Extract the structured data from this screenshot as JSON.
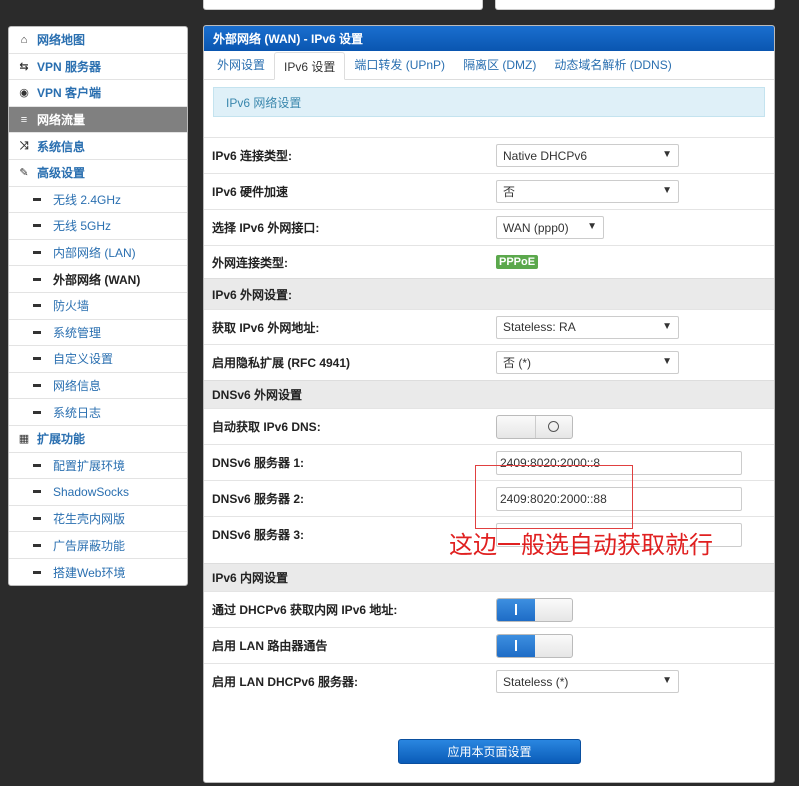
{
  "sidebar": {
    "items": [
      {
        "label": "网络地图",
        "icon": "home-icon",
        "glyph": "⌂",
        "type": "main"
      },
      {
        "label": "VPN 服务器",
        "icon": "retweet-icon",
        "glyph": "⇆",
        "type": "main"
      },
      {
        "label": "VPN 客户端",
        "icon": "globe-icon",
        "glyph": "◉",
        "type": "main"
      },
      {
        "label": "网络流量",
        "icon": "list-icon",
        "glyph": "≡",
        "type": "main",
        "active": true
      },
      {
        "label": "系统信息",
        "icon": "shuffle-icon",
        "glyph": "⤨",
        "type": "main"
      },
      {
        "label": "高级设置",
        "icon": "wrench-icon",
        "glyph": "✎",
        "type": "main"
      },
      {
        "label": "无线 2.4GHz",
        "type": "sub"
      },
      {
        "label": "无线 5GHz",
        "type": "sub"
      },
      {
        "label": "内部网络 (LAN)",
        "type": "sub"
      },
      {
        "label": "外部网络 (WAN)",
        "type": "sub",
        "current": true
      },
      {
        "label": "防火墙",
        "type": "sub"
      },
      {
        "label": "系统管理",
        "type": "sub"
      },
      {
        "label": "自定义设置",
        "type": "sub"
      },
      {
        "label": "网络信息",
        "type": "sub"
      },
      {
        "label": "系统日志",
        "type": "sub"
      },
      {
        "label": "扩展功能",
        "icon": "grid-icon",
        "glyph": "▦",
        "type": "main"
      },
      {
        "label": "配置扩展环境",
        "type": "sub"
      },
      {
        "label": "ShadowSocks",
        "type": "sub"
      },
      {
        "label": "花生壳内网版",
        "type": "sub"
      },
      {
        "label": "广告屏蔽功能",
        "type": "sub"
      },
      {
        "label": "搭建Web环境",
        "type": "sub"
      }
    ]
  },
  "panel": {
    "title": "外部网络 (WAN) - IPv6 设置",
    "tabs": [
      "外网设置",
      "IPv6 设置",
      "端口转发 (UPnP)",
      "隔离区 (DMZ)",
      "动态域名解析 (DDNS)"
    ],
    "active_tab": 1,
    "info": "IPv6 网络设置"
  },
  "form": {
    "conn_type_label": "IPv6 连接类型:",
    "conn_type_value": "Native DHCPv6",
    "hw_accel_label": "IPv6 硬件加速",
    "hw_accel_value": "否",
    "wan_if_label": "选择 IPv6 外网接口:",
    "wan_if_value": "WAN (ppp0)",
    "wan_conn_label": "外网连接类型:",
    "wan_conn_badge": "PPPoE",
    "sect_wan": "IPv6 外网设置:",
    "get_addr_label": "获取 IPv6 外网地址:",
    "get_addr_value": "Stateless: RA",
    "privacy_label": "启用隐私扩展 (RFC 4941)",
    "privacy_value": "否 (*)",
    "sect_dns": "DNSv6 外网设置",
    "auto_dns_label": "自动获取 IPv6 DNS:",
    "auto_dns_on": false,
    "dns1_label": "DNSv6 服务器 1:",
    "dns1_value": "2409:8020:2000::8",
    "dns2_label": "DNSv6 服务器 2:",
    "dns2_value": "2409:8020:2000::88",
    "dns3_label": "DNSv6 服务器 3:",
    "dns3_value": "",
    "sect_lan": "IPv6 内网设置",
    "dhcpv6_lan_label": "通过 DHCPv6 获取内网 IPv6 地址:",
    "dhcpv6_lan_on": true,
    "lan_ra_label": "启用 LAN 路由器通告",
    "lan_ra_on": true,
    "lan_dhcpv6_label": "启用 LAN DHCPv6 服务器:",
    "lan_dhcpv6_value": "Stateless (*)",
    "apply_label": "应用本页面设置"
  },
  "annotation": {
    "text": "这边一般选自动获取就行",
    "color": "#e02020"
  }
}
